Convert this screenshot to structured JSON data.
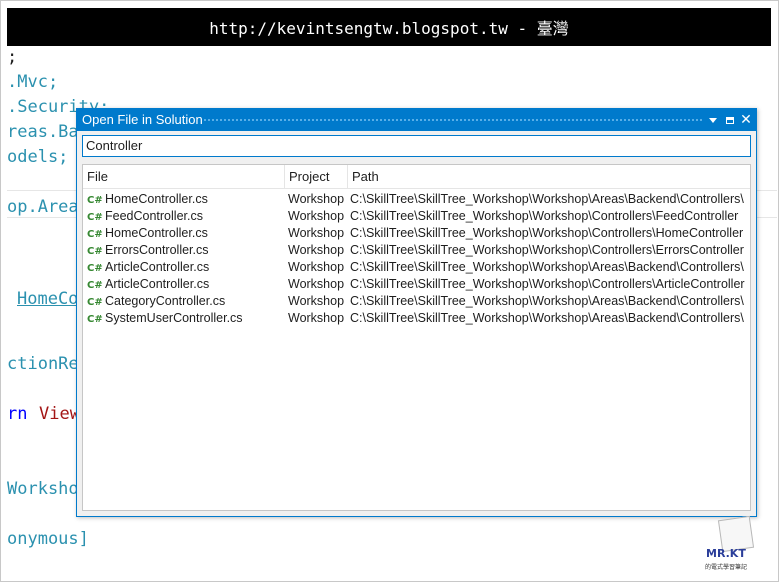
{
  "banner": {
    "text": "http://kevintsengtw.blogspot.tw - 臺灣"
  },
  "editor": {
    "lines": [
      ";",
      ".Mvc;",
      ".Security;",
      "reas.Ba",
      "odels;",
      "op.Area",
      "HomeCo",
      "ctionRe",
      "rn",
      "View",
      "Workshop",
      "onymous]"
    ]
  },
  "dialog": {
    "title": "Open File in Solution",
    "search_value": "Controller",
    "columns": {
      "file": "File",
      "project": "Project",
      "path": "Path"
    },
    "rows": [
      {
        "file": "HomeController.cs",
        "project": "Workshop",
        "path": "C:\\SkillTree\\SkillTree_Workshop\\Workshop\\Areas\\Backend\\Controllers\\"
      },
      {
        "file": "FeedController.cs",
        "project": "Workshop",
        "path": "C:\\SkillTree\\SkillTree_Workshop\\Workshop\\Controllers\\FeedController"
      },
      {
        "file": "HomeController.cs",
        "project": "Workshop",
        "path": "C:\\SkillTree\\SkillTree_Workshop\\Workshop\\Controllers\\HomeController"
      },
      {
        "file": "ErrorsController.cs",
        "project": "Workshop",
        "path": "C:\\SkillTree\\SkillTree_Workshop\\Workshop\\Controllers\\ErrorsController"
      },
      {
        "file": "ArticleController.cs",
        "project": "Workshop",
        "path": "C:\\SkillTree\\SkillTree_Workshop\\Workshop\\Areas\\Backend\\Controllers\\"
      },
      {
        "file": "ArticleController.cs",
        "project": "Workshop",
        "path": "C:\\SkillTree\\SkillTree_Workshop\\Workshop\\Controllers\\ArticleController"
      },
      {
        "file": "CategoryController.cs",
        "project": "Workshop",
        "path": "C:\\SkillTree\\SkillTree_Workshop\\Workshop\\Areas\\Backend\\Controllers\\"
      },
      {
        "file": "SystemUserController.cs",
        "project": "Workshop",
        "path": "C:\\SkillTree\\SkillTree_Workshop\\Workshop\\Areas\\Backend\\Controllers\\"
      }
    ],
    "row_icon": "csharp-file-icon",
    "row_icon_glyph": "C#"
  },
  "logo": {
    "text": "MR.KT",
    "subtitle": "的電式學習筆記"
  },
  "colors": {
    "accent": "#007acc",
    "banner_bg": "#000000",
    "teal": "#2b91af",
    "red": "#a31515",
    "csharp_icon": "#368832"
  }
}
